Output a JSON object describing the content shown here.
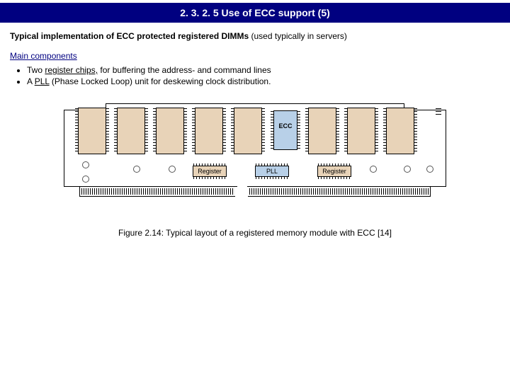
{
  "title": "2. 3. 2. 5 Use of ECC support (5)",
  "subtitle_bold": "Typical implementation of ECC protected registered DIMMs",
  "subtitle_rest": " (used typically in servers)",
  "section_head": "Main components",
  "bullets": {
    "b0_pre": "Two ",
    "b0_ul": "register chips,",
    "b0_post": " for buffering the address- and command lines",
    "b1_pre": "A ",
    "b1_ul": "PLL",
    "b1_post": " (Phase Locked Loop) unit for deskewing clock distribution."
  },
  "labels": {
    "ecc": "ECC",
    "register": "Register",
    "pll": "PLL"
  },
  "caption": "Figure 2.14: Typical layout of a registered memory module with ECC [14]"
}
